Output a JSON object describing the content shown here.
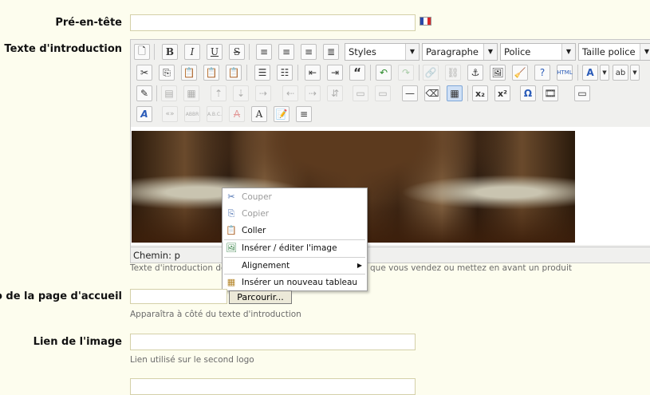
{
  "labels": {
    "preheader": "Pré-en-tête",
    "intro": "Texte d'introduction",
    "logo": "ogo de la page d'accueil",
    "image_link": "Lien de l'image"
  },
  "toolbar": {
    "styles": "Styles",
    "paragraph": "Paragraphe",
    "font": "Police",
    "font_size": "Taille police"
  },
  "editor": {
    "status_path": "Chemin: p"
  },
  "hints": {
    "intro_left": "Texte d'introduction de v",
    "intro_right": "que vous vendez ou mettez en avant un produit",
    "logo": "Apparaîtra à côté du texte d'introduction",
    "image_link": "Lien utilisé sur le second logo"
  },
  "context_menu": {
    "cut": "Couper",
    "copy": "Copier",
    "paste": "Coller",
    "insert_image": "Insérer / éditer l'image",
    "alignment": "Alignement",
    "insert_table": "Insérer un nouveau tableau"
  },
  "browse_button": "Parcourir...",
  "colors": {
    "background": "#fdfdee",
    "flag_blue": "#2b48a8",
    "flag_white": "#ffffff",
    "flag_red": "#d82a2a"
  }
}
